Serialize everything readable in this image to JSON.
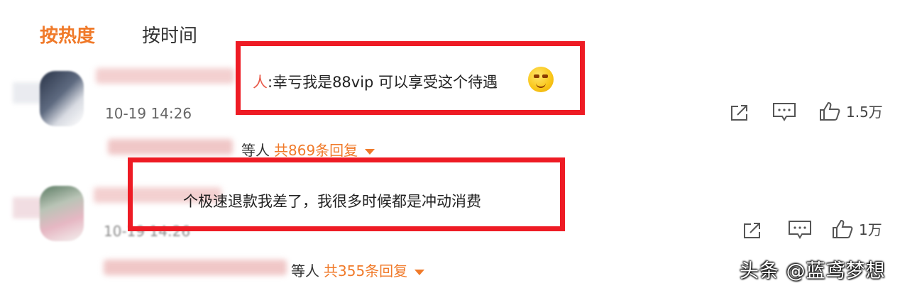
{
  "tabs": {
    "hot": "按热度",
    "time": "按时间"
  },
  "comments": [
    {
      "text_name_fragment": "人",
      "text": ":幸亏我是88vip 可以享受这个待遇",
      "timestamp": "10-19 14:26",
      "share_icon": "share-icon",
      "comment_icon": "comment-icon",
      "like_icon": "thumbs-up-icon",
      "like_count": "1.5万",
      "reply_suffix": "等人",
      "reply_count": "共869条回复"
    },
    {
      "text": "个极速退款我差了，我很多时候都是冲动消费",
      "timestamp": "10-19 14:26",
      "share_icon": "share-icon",
      "comment_icon": "comment-icon",
      "like_icon": "thumbs-up-icon",
      "like_count": "1万",
      "reply_suffix": "等人",
      "reply_count": "共355条回复"
    }
  ],
  "colors": {
    "accent": "#f07a2a",
    "highlight_box": "#ee1b24"
  },
  "watermark": "头条 @蓝鸢梦想"
}
